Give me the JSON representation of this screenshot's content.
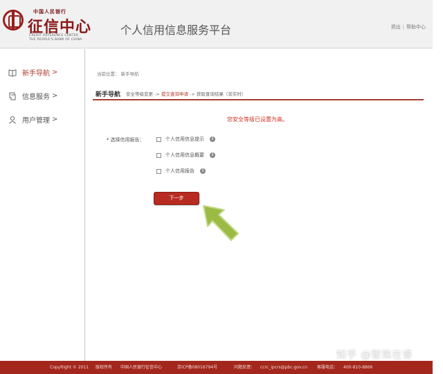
{
  "header": {
    "logo_top": "中国人民银行",
    "logo_name": "征信中心",
    "logo_en_line1": "CREDIT REFERENCE CENTER",
    "logo_en_line2": "THE PEOPLE'S BANK OF CHINA",
    "platform_title": "个人信用信息服务平台",
    "logout": "退出",
    "separator": "|",
    "help": "帮助中心"
  },
  "sidebar": {
    "items": [
      {
        "label": "新手导航",
        "arrow": ">",
        "icon": "book-icon",
        "active": true
      },
      {
        "label": "信息服务",
        "arrow": ">",
        "icon": "document-icon",
        "active": false
      },
      {
        "label": "用户管理",
        "arrow": ">",
        "icon": "user-icon",
        "active": false
      }
    ]
  },
  "main": {
    "breadcrumb_prefix": "当前位置：",
    "breadcrumb_current": "新手导航",
    "steps_title": "新手导航",
    "step1": "安全等级变更 -> ",
    "step2": "提交查询申请",
    "step3": " -> 获取查询结果（非实时）",
    "notice": "您安全等级已设置为高。",
    "form_label_required": "*",
    "form_label": "选择信用报告：",
    "options": [
      {
        "label": "个人信用信息提示",
        "checked": false
      },
      {
        "label": "个人信用信息概要",
        "checked": false
      },
      {
        "label": "个人信用报告",
        "checked": false
      }
    ],
    "info_glyph": "i",
    "next_button": "下一步"
  },
  "footer": {
    "copyright": "CopyRight © 2011",
    "rights": "版权所有",
    "org": "中国人民银行征信中心",
    "icp": "京ICP备08016794号",
    "feedback": "问题反馈：",
    "email": "ccrc_ipcrs@pbc.gov.cn",
    "hotline_label": "客服电话：",
    "hotline": "400-810-8866"
  },
  "watermark": "知乎 @智珠在睿",
  "colors": {
    "brand_red": "#a3271c",
    "accent_red": "#b82b22",
    "notice_red": "#cc3322",
    "pointer_green": "#9bbb45"
  }
}
